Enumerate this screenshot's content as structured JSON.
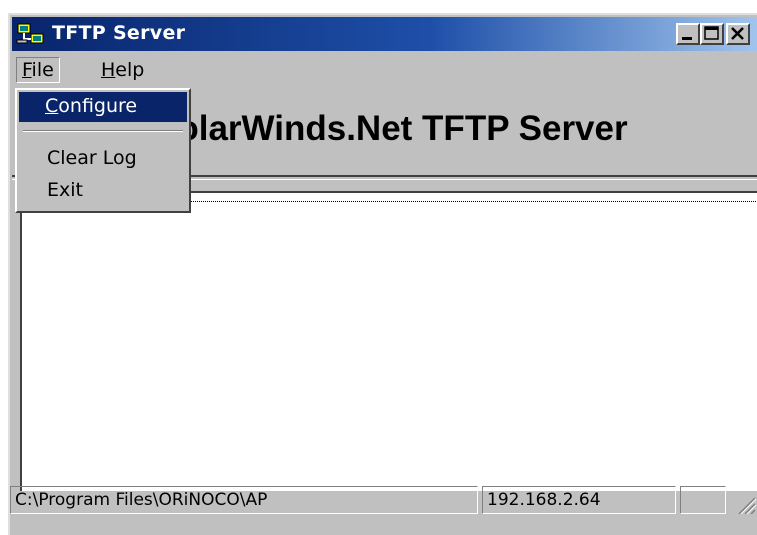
{
  "window": {
    "title": "TFTP Server",
    "controls": [
      "minimize-icon",
      "maximize-icon",
      "close-icon"
    ]
  },
  "menubar": {
    "file_label": "File",
    "help_label": "Help"
  },
  "header": {
    "title": "SolarWinds.Net TFTP Server"
  },
  "file_menu": {
    "items": [
      {
        "label": "Configure",
        "selected": true
      },
      {
        "label": "Clear Log"
      },
      {
        "label": "Exit"
      }
    ]
  },
  "statusbar": {
    "path": "C:\\Program Files\\ORiNOCO\\AP",
    "ip": "192.168.2.64",
    "extra": ""
  },
  "colors": {
    "titlebar_start": "#08246b",
    "titlebar_end": "#a6caf0",
    "menu_highlight": "#0a246a",
    "face": "#c0c0c0"
  }
}
